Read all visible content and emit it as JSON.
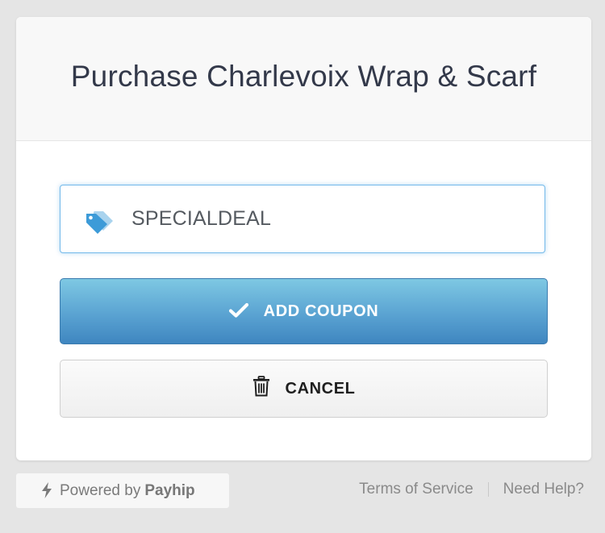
{
  "modal": {
    "title": "Purchase Charlevoix Wrap & Scarf"
  },
  "coupon": {
    "value": "SPECIALDEAL",
    "placeholder": "",
    "icon": "tag-icon"
  },
  "buttons": {
    "add_coupon": {
      "label": "ADD COUPON",
      "icon": "check-icon"
    },
    "cancel": {
      "label": "CANCEL",
      "icon": "trash-icon"
    }
  },
  "footer": {
    "powered_prefix": "Powered by",
    "brand": "Payhip",
    "bolt_icon": "bolt-icon",
    "links": {
      "terms": "Terms of Service",
      "help": "Need Help?"
    }
  },
  "colors": {
    "accent_border": "#73b9ea",
    "primary_button_top": "#7ec8e3",
    "primary_button_bottom": "#3f86c0",
    "title_text": "#33394a",
    "page_background": "#e5e5e5"
  }
}
